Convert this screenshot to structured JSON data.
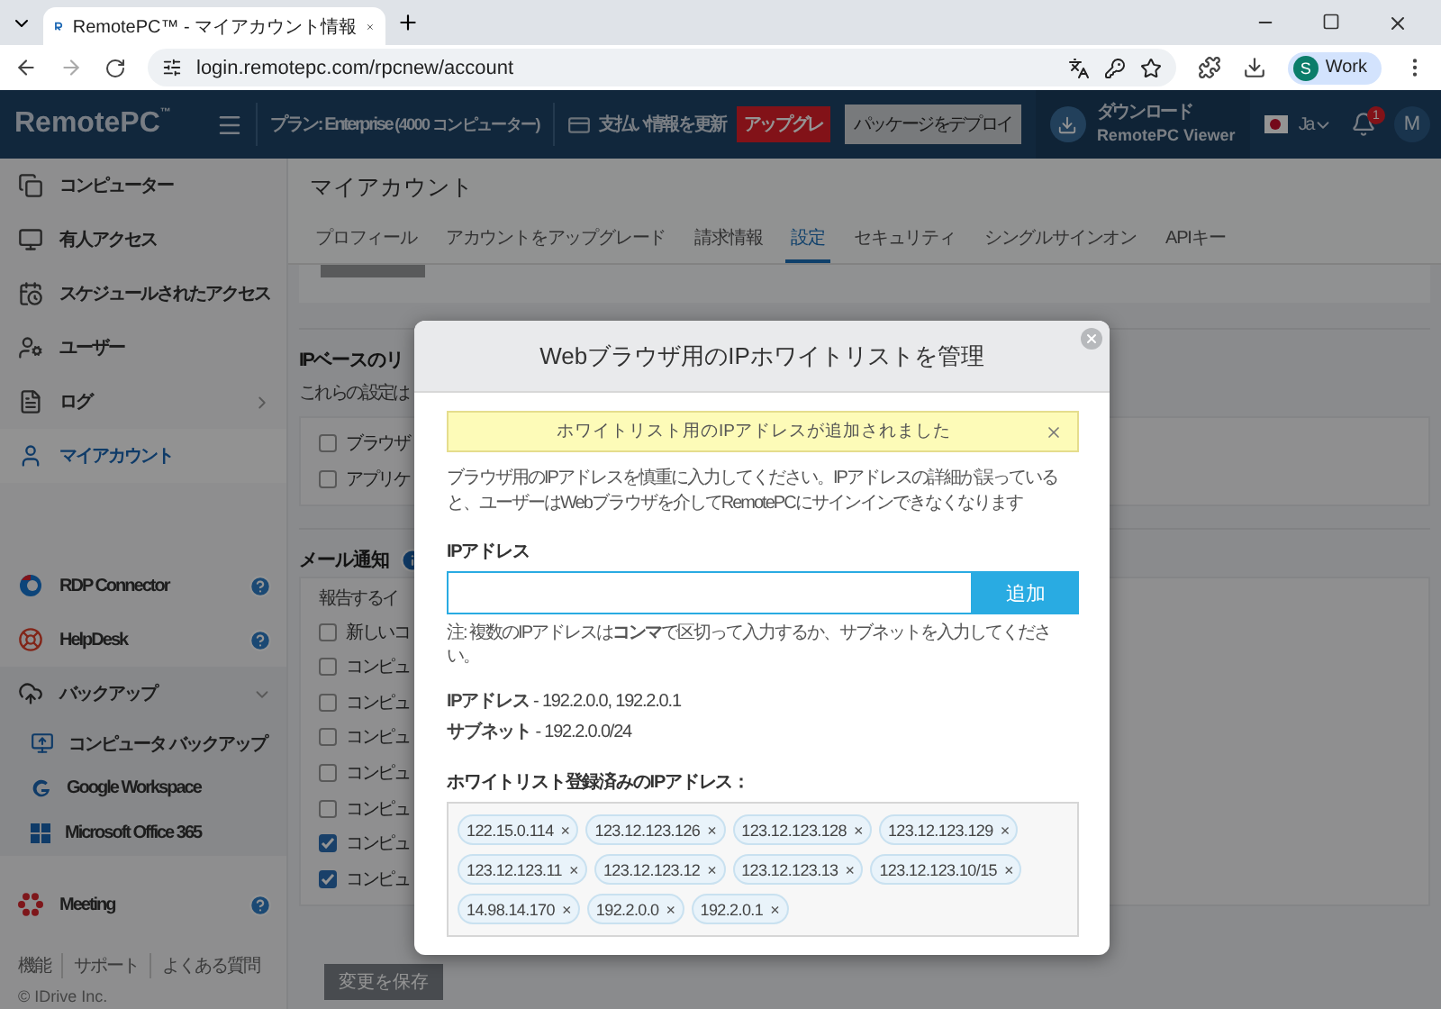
{
  "browser": {
    "tab_title": "RemotePC™ - マイアカウント情報",
    "url": "login.remotepc.com/rpcnew/account",
    "profile_initial": "S",
    "profile_name": "Work"
  },
  "header": {
    "logo": "RemotePC",
    "logo_mark": "™",
    "plan": "プラン: Enterprise",
    "plan_count": "(4000 コンピューター)",
    "billing": "支払い情報を更新",
    "upgrade": "アップグレ",
    "deploy": "パッケージをデプロイ",
    "download_line1": "ダウンロード",
    "download_line2": "RemotePC Viewer",
    "language": "Ja",
    "notifications": "1",
    "avatar": "M"
  },
  "sidebar": {
    "nav": [
      {
        "label": "コンピューター",
        "kind": "link",
        "selected": false
      },
      {
        "label": "有人アクセス",
        "kind": "link",
        "selected": false
      },
      {
        "label": "スケジュールされたアクセス",
        "kind": "link",
        "selected": false
      },
      {
        "label": "ユーザー",
        "kind": "link",
        "selected": false
      },
      {
        "label": "ログ",
        "kind": "menu",
        "expanded": false,
        "selected": false
      },
      {
        "label": "マイアカウント",
        "kind": "link",
        "selected": true
      }
    ],
    "apps": [
      {
        "label": "RDP Connector",
        "kind": "help"
      },
      {
        "label": "HelpDesk",
        "kind": "help"
      },
      {
        "label": "バックアップ",
        "kind": "group",
        "expanded": true,
        "children": [
          {
            "label": "コンピュータ バックアップ"
          },
          {
            "label": "Google Workspace"
          },
          {
            "label": "Microsoft Office 365"
          }
        ]
      },
      {
        "label": "Meeting",
        "kind": "help"
      }
    ],
    "footer_links": [
      "機能",
      "サポート",
      "よくある質問"
    ],
    "copyright": "© IDrive Inc."
  },
  "page": {
    "title": "マイアカウント",
    "tabs": [
      {
        "label": "プロフィール",
        "selected": false
      },
      {
        "label": "アカウントをアップグレード",
        "selected": false
      },
      {
        "label": "請求情報",
        "selected": false
      },
      {
        "label": "設定",
        "selected": true
      },
      {
        "label": "セキュリティ",
        "selected": false
      },
      {
        "label": "シングルサインオン",
        "selected": false
      },
      {
        "label": "APIキー",
        "selected": false
      }
    ],
    "ip_section": {
      "heading": "IPベースのリ",
      "description": "これらの設定は",
      "options": [
        {
          "label": "ブラウザ",
          "checked": false
        },
        {
          "label": "アプリケ",
          "checked": false
        }
      ]
    },
    "email_section": {
      "heading": "メール通知",
      "subheading": "報告するイ",
      "options": [
        {
          "label": "新しいコ",
          "checked": false
        },
        {
          "label": "コンピュ",
          "checked": false
        },
        {
          "label": "コンピュ",
          "checked": false
        },
        {
          "label": "コンピュ",
          "checked": false
        },
        {
          "label": "コンピュ",
          "checked": false
        },
        {
          "label": "コンピュ",
          "checked": false
        },
        {
          "label": "コンピュ",
          "checked": true
        },
        {
          "label": "コンピュ",
          "checked": true
        }
      ]
    },
    "save_button": "変更を保存"
  },
  "modal": {
    "title": "Webブラウザ用のIPホワイトリストを管理",
    "alert": "ホワイトリスト用のIPアドレスが追加されました",
    "instructions": "ブラウザ用のIPアドレスを慎重に入力してください。IPアドレスの詳細が誤っていると、ユーザーはWebブラウザを介してRemotePCにサインインできなくなります",
    "ip_label": "IPアドレス",
    "add_button": "追加",
    "note": "注: 複数のIPアドレスは**コンマ**で区切って入力するか、サブネットを入力してください。",
    "examples": [
      "**IPアドレス** - 192.2.0.0, 192.2.0.1",
      "**サブネット** - 192.2.0.0/24"
    ],
    "whitelist_label": "ホワイトリスト登録済みのIPアドレス：",
    "remove_mark": "×",
    "whitelist": [
      "122.15.0.114",
      "123.12.123.126",
      "123.12.123.128",
      "123.12.123.129",
      "123.12.123.11",
      "123.12.123.12",
      "123.12.123.13",
      "123.12.123.10/15",
      "14.98.14.170",
      "192.2.0.0",
      "192.2.0.1"
    ]
  }
}
